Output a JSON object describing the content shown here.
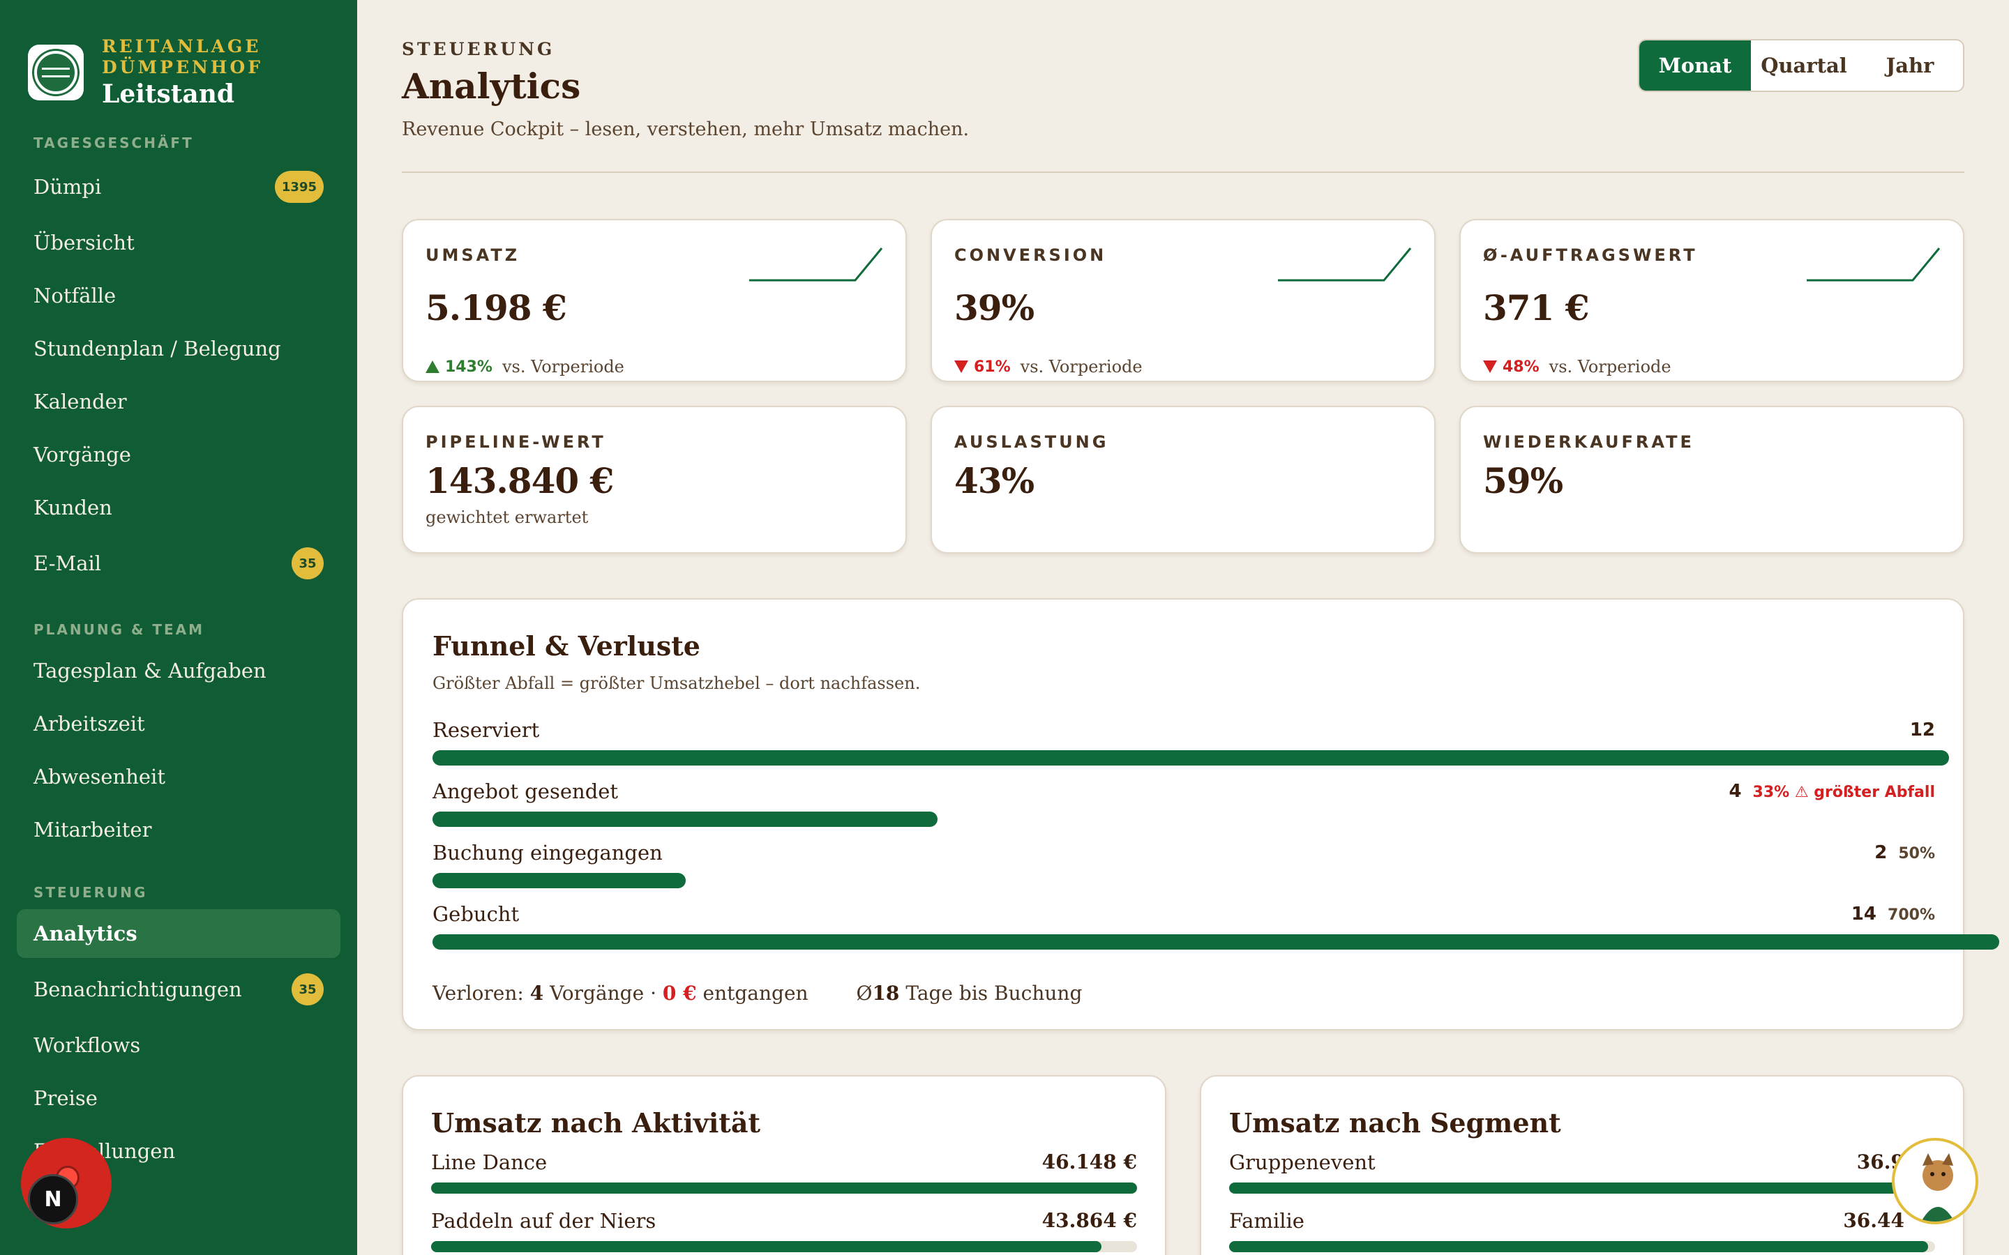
{
  "brand": {
    "line1": "REITANLAGE",
    "line2": "DÜMPENHOF",
    "title": "Leitstand"
  },
  "sidebar": {
    "sections": [
      {
        "label": "TAGESGESCHÄFT",
        "items": [
          {
            "label": "Dümpi",
            "badge": "1395"
          },
          {
            "label": "Übersicht"
          },
          {
            "label": "Notfälle"
          },
          {
            "label": "Stundenplan / Belegung"
          },
          {
            "label": "Kalender"
          },
          {
            "label": "Vorgänge"
          },
          {
            "label": "Kunden"
          },
          {
            "label": "E-Mail",
            "badge": "35"
          }
        ]
      },
      {
        "label": "PLANUNG & TEAM",
        "items": [
          {
            "label": "Tagesplan & Aufgaben"
          },
          {
            "label": "Arbeitszeit"
          },
          {
            "label": "Abwesenheit"
          },
          {
            "label": "Mitarbeiter"
          }
        ]
      },
      {
        "label": "STEUERUNG",
        "items": [
          {
            "label": "Analytics",
            "active": true
          },
          {
            "label": "Benachrichtigungen",
            "badge": "35"
          },
          {
            "label": "Workflows"
          },
          {
            "label": "Preise"
          },
          {
            "label": "Einstellungen"
          }
        ]
      }
    ]
  },
  "fab": {
    "label": "N"
  },
  "header": {
    "eyebrow": "STEUERUNG",
    "title": "Analytics",
    "subtitle": "Revenue Cockpit – lesen, verstehen, mehr Umsatz machen.",
    "periods": [
      "Monat",
      "Quartal",
      "Jahr"
    ],
    "active_period": "Monat"
  },
  "kpis": {
    "umsatz": {
      "label": "UMSATZ",
      "value": "5.198 €",
      "delta": "143%",
      "direction": "up",
      "ref": "vs. Vorperiode"
    },
    "conversion": {
      "label": "CONVERSION",
      "value": "39%",
      "delta": "61%",
      "direction": "down",
      "ref": "vs. Vorperiode"
    },
    "aov": {
      "label": "Ø-AUFTRAGSWERT",
      "value": "371 €",
      "delta": "48%",
      "direction": "down",
      "ref": "vs. Vorperiode"
    },
    "pipeline": {
      "label": "PIPELINE-WERT",
      "value": "143.840 €",
      "note": "gewichtet erwartet"
    },
    "auslastung": {
      "label": "AUSLASTUNG",
      "value": "43%"
    },
    "wiederkauf": {
      "label": "WIEDERKAUFRATE",
      "value": "59%"
    }
  },
  "funnel": {
    "title": "Funnel & Verluste",
    "subtitle": "Größter Abfall = größter Umsatzhebel – dort nachfassen.",
    "stages": [
      {
        "label": "Reserviert",
        "count": "12",
        "pct": "",
        "bar": 1.0
      },
      {
        "label": "Angebot gesendet",
        "count": "4",
        "pct": "33% ⚠ größter Abfall",
        "warn": true,
        "bar": 0.333
      },
      {
        "label": "Buchung eingegangen",
        "count": "2",
        "pct": "50%",
        "bar": 0.167
      },
      {
        "label": "Gebucht",
        "count": "14",
        "pct": "700%",
        "bar": 1.167
      }
    ],
    "footer": {
      "lost_prefix": "Verloren:",
      "lost_count": "4",
      "lost_mid": "Vorgänge ·",
      "lost_value": "0 €",
      "lost_suffix": "entgangen",
      "days_prefix": "Ø",
      "days": "18",
      "days_suffix": "Tage bis Buchung"
    }
  },
  "by_activity": {
    "title": "Umsatz nach Aktivität",
    "rows": [
      {
        "label": "Line Dance",
        "value": "46.148 €",
        "fill": 1.0
      },
      {
        "label": "Paddeln auf der Niers",
        "value": "43.864 €",
        "fill": 0.95
      }
    ]
  },
  "by_segment": {
    "title": "Umsatz nach Segment",
    "rows": [
      {
        "label": "Gruppenevent",
        "value": "36.9",
        "fill": 1.0
      },
      {
        "label": "Familie",
        "value": "36.44",
        "fill": 0.99
      }
    ]
  },
  "colors": {
    "sidebar": "#0f5c35",
    "accent": "#0f6b3b",
    "gold": "#e2bd3c",
    "danger": "#d42020",
    "background": "#f2eee5"
  },
  "icons": {
    "logo": "brand-logo-icon",
    "fab": "assistant-icon",
    "mascot": "mascot-icon",
    "up": "triangle-up-icon",
    "down": "triangle-down-icon"
  }
}
